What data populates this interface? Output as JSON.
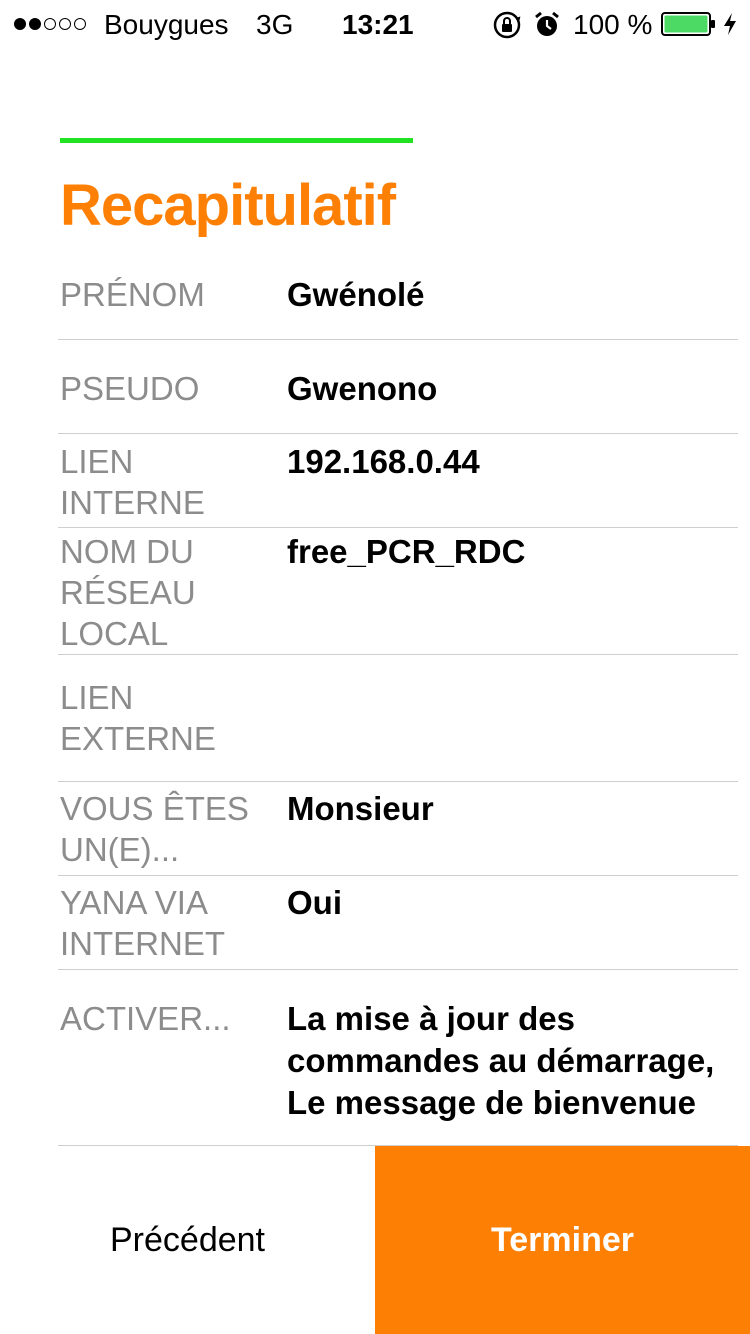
{
  "status_bar": {
    "signal_bars_filled": 2,
    "signal_bars_total": 5,
    "carrier": "Bouygues",
    "network": "3G",
    "time": "13:21",
    "lock_icon": "rotation-lock-icon",
    "alarm_icon": "alarm-clock-icon",
    "battery_percent": "100 %",
    "battery_level": 1.0,
    "battery_color": "#4cd964",
    "charging_icon": "bolt-icon"
  },
  "progress": {
    "color": "#21e321"
  },
  "title": "Recapitulatif",
  "summary": {
    "rows": [
      {
        "label": "PRÉNOM",
        "value": "Gwénolé"
      },
      {
        "label": "PSEUDO",
        "value": "Gwenono"
      },
      {
        "label": "LIEN\nINTERNE",
        "value": "192.168.0.44"
      },
      {
        "label": "NOM DU\nRÉSEAU\nLOCAL",
        "value": "free_PCR_RDC"
      },
      {
        "label": "LIEN\nEXTERNE",
        "value": ""
      },
      {
        "label": "VOUS ÊTES\nUN(E)...",
        "value": "Monsieur"
      },
      {
        "label": "YANA VIA\nINTERNET",
        "value": "Oui"
      },
      {
        "label": "ACTIVER...",
        "value": "La mise à jour des\ncommandes au démarrage,\nLe message de bienvenue"
      }
    ]
  },
  "buttons": {
    "previous": "Précédent",
    "finish": "Terminer"
  },
  "colors": {
    "accent": "#fd8005",
    "label": "#8c8c8c",
    "divider": "#cfcfcf"
  }
}
